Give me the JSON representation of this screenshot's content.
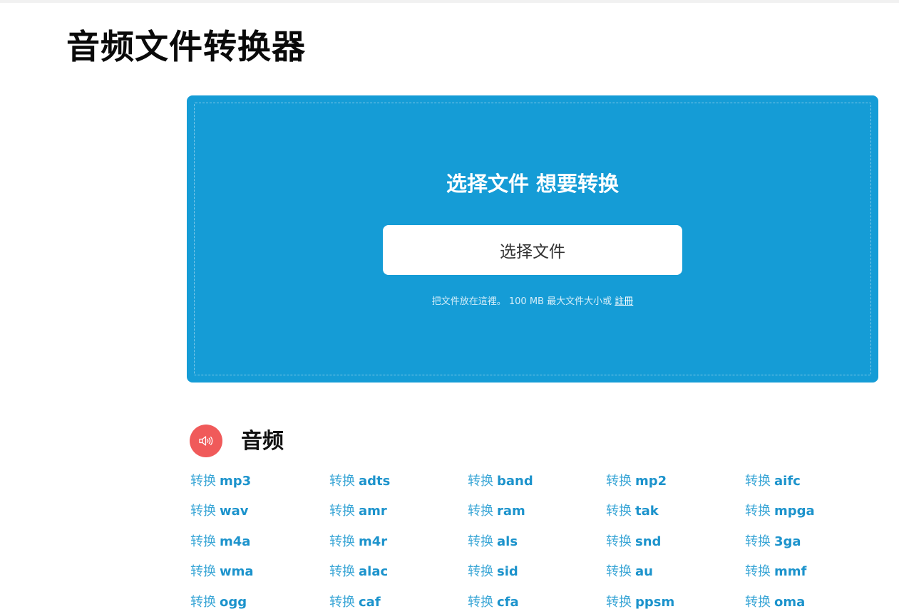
{
  "page": {
    "title": "音频文件转换器"
  },
  "upload": {
    "heading": "选择文件 想要转换",
    "button_label": "选择文件",
    "note_text": "把文件放在這裡。 100 MB 最大文件大小或 ",
    "register_link": "註冊"
  },
  "section": {
    "icon": "speaker-icon",
    "title": "音频",
    "verb": "转换",
    "rows": [
      [
        "mp3",
        "adts",
        "band",
        "mp2",
        "aifc"
      ],
      [
        "wav",
        "amr",
        "ram",
        "tak",
        "mpga"
      ],
      [
        "m4a",
        "m4r",
        "als",
        "snd",
        "3ga"
      ],
      [
        "wma",
        "alac",
        "sid",
        "au",
        "mmf"
      ],
      [
        "ogg",
        "caf",
        "cfa",
        "ppsm",
        "oma"
      ]
    ]
  },
  "colors": {
    "panel": "#159cd6",
    "icon_badge": "#f05a5a",
    "link": "#1c93cc"
  }
}
